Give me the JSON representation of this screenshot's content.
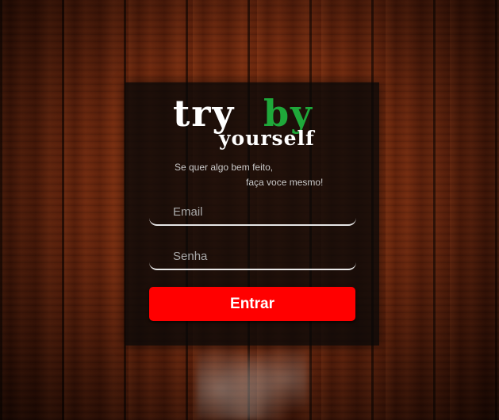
{
  "logo": {
    "word_try": "try",
    "word_by": "by",
    "word_yourself": "yourself"
  },
  "tagline": {
    "line1": "Se quer algo bem feito,",
    "line2": "faça voce mesmo!"
  },
  "form": {
    "email_placeholder": "Email",
    "email_value": "",
    "password_placeholder": "Senha",
    "password_value": "",
    "submit_label": "Entrar"
  },
  "colors": {
    "accent_red": "#ff0000",
    "logo_green": "#1fa83a",
    "card_background": "#080808"
  }
}
